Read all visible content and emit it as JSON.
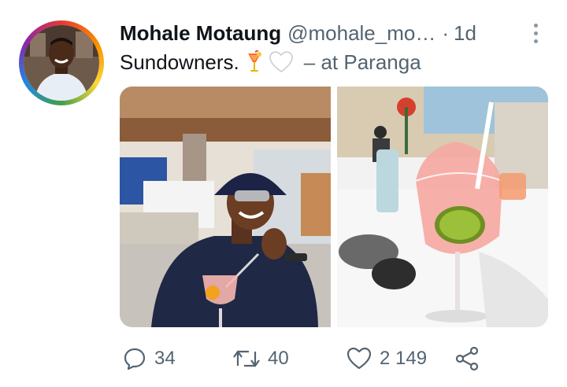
{
  "tweet": {
    "author_name": "Mohale Motaung",
    "handle": "@mohale_mo…",
    "separator": "·",
    "time": "1d",
    "text": "Sundowners.",
    "location_text": "– at Paranga"
  },
  "actions": {
    "reply_count": "34",
    "retweet_count": "40",
    "like_count": "2 149"
  },
  "icons": {
    "reply": "comment-icon",
    "retweet": "retweet-icon",
    "like": "heart-icon",
    "share": "share-icon",
    "more": "more-options-icon",
    "emoji_1": "tropical-drink-emoji",
    "emoji_2": "white-heart-emoji"
  },
  "colors": {
    "text_primary": "#0f1419",
    "text_secondary": "#536471"
  }
}
